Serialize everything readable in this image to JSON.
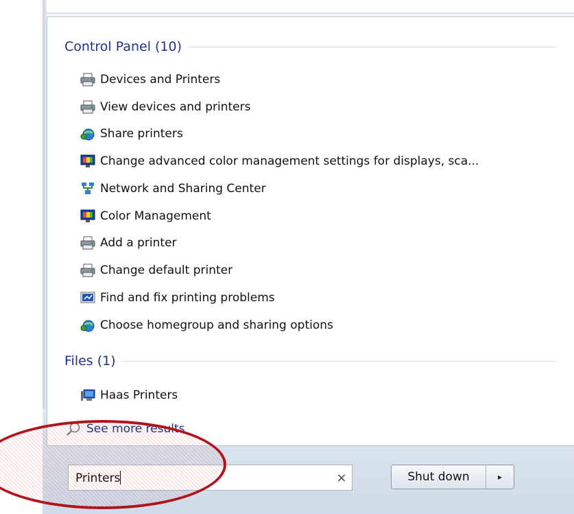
{
  "control_panel": {
    "header": "Control Panel (10)",
    "items": [
      {
        "label": "Devices and Printers",
        "icon": "printer-icon"
      },
      {
        "label": "View devices and printers",
        "icon": "printer-icon"
      },
      {
        "label": "Share printers",
        "icon": "sharing-globe-icon"
      },
      {
        "label": "Change advanced color management settings for displays, sca...",
        "icon": "color-monitor-icon"
      },
      {
        "label": "Network and Sharing Center",
        "icon": "network-icon"
      },
      {
        "label": "Color Management",
        "icon": "color-monitor-icon"
      },
      {
        "label": "Add a printer",
        "icon": "printer-icon"
      },
      {
        "label": "Change default printer",
        "icon": "printer-icon"
      },
      {
        "label": "Find and fix printing problems",
        "icon": "troubleshoot-icon"
      },
      {
        "label": "Choose homegroup and sharing options",
        "icon": "sharing-globe-icon"
      }
    ]
  },
  "files": {
    "header": "Files (1)",
    "items": [
      {
        "label": "Haas Printers",
        "icon": "file-monitor-icon"
      }
    ]
  },
  "see_more": {
    "label": "See more results",
    "icon": "search-icon"
  },
  "search": {
    "value": "Printers",
    "clear": "×"
  },
  "shutdown": {
    "label": "Shut down",
    "arrow": "▸"
  },
  "colors": {
    "header_text": "#1e3287",
    "highlight_ring": "#b0141a"
  }
}
